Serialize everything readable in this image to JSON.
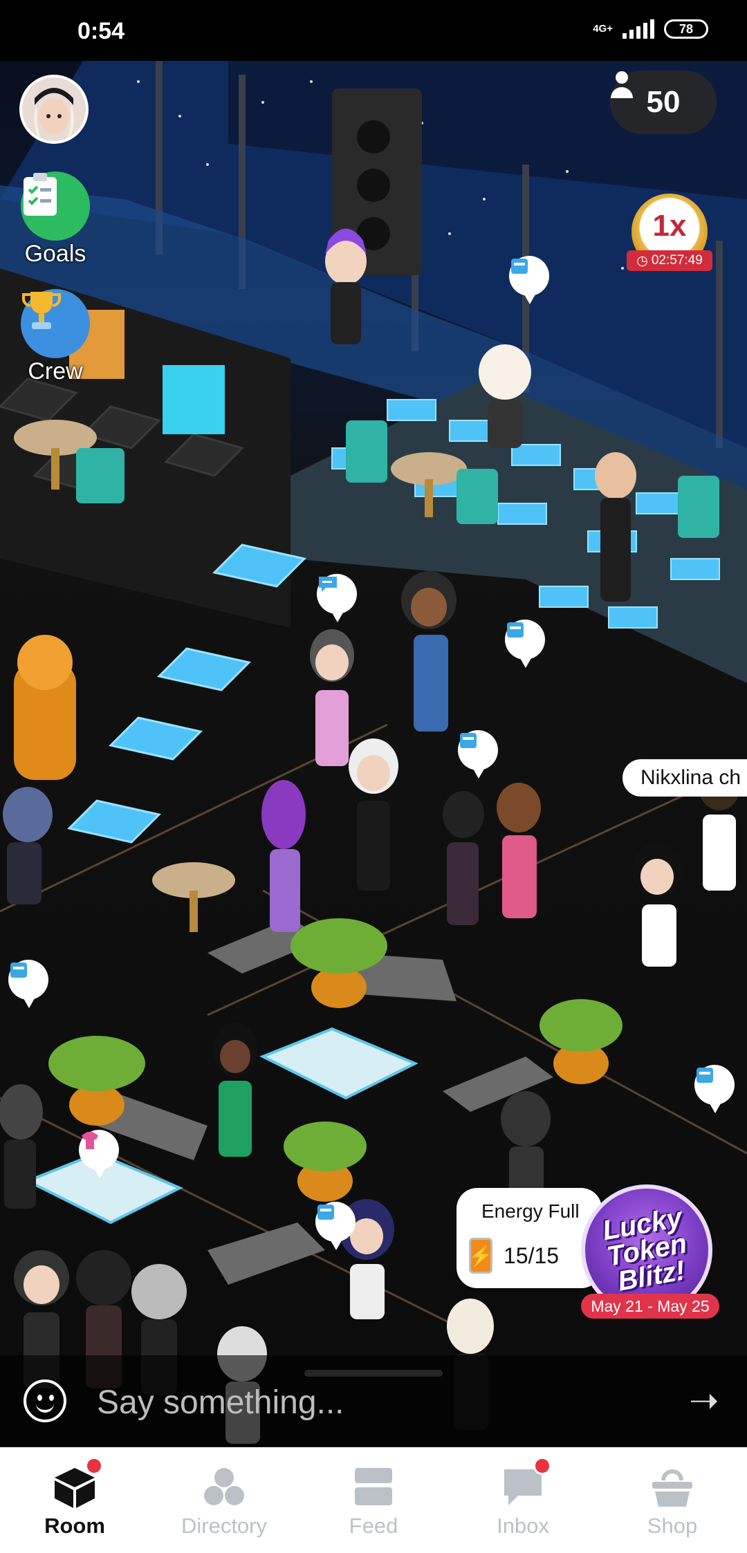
{
  "status_bar": {
    "time": "0:54",
    "network": "4G+",
    "battery": "78"
  },
  "room": {
    "user_count": "50",
    "side_buttons": [
      {
        "label": "Goals",
        "icon": "clipboard-checklist-icon"
      },
      {
        "label": "Crew",
        "icon": "trophy-icon"
      }
    ],
    "multiplier": {
      "label": "1x",
      "timer": "02:57:49"
    },
    "name_tag": "Nikxlina ch",
    "energy": {
      "title": "Energy Full",
      "value": "15/15"
    },
    "event": {
      "title_line1": "Lucky",
      "title_line2": "Token",
      "title_line3": "Blitz!",
      "dates": "May 21 - May 25"
    }
  },
  "chat": {
    "placeholder": "Say something..."
  },
  "nav": {
    "items": [
      {
        "label": "Room",
        "icon": "cube-icon",
        "active": true,
        "badge": true
      },
      {
        "label": "Directory",
        "icon": "hexagons-icon",
        "active": false,
        "badge": false
      },
      {
        "label": "Feed",
        "icon": "feed-cards-icon",
        "active": false,
        "badge": false
      },
      {
        "label": "Inbox",
        "icon": "chat-bubble-icon",
        "active": false,
        "badge": true
      },
      {
        "label": "Shop",
        "icon": "shopping-basket-icon",
        "active": false,
        "badge": false
      }
    ]
  },
  "colors": {
    "accent_red": "#e8333f",
    "event_purple": "#7b3cc4",
    "floor_cyan": "#4fc3f7"
  }
}
